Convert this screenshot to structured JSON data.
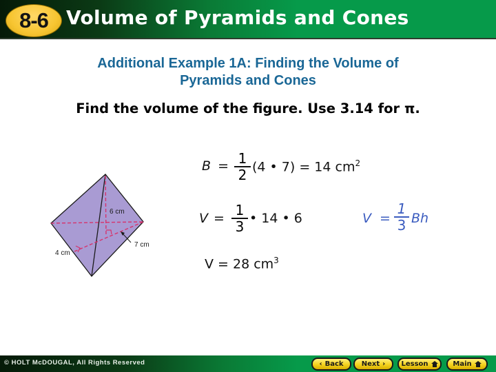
{
  "header": {
    "lesson_badge": "8-6",
    "title": "Volume of Pyramids and Cones",
    "colors": {
      "badge": "#f7c531",
      "band_dark": "#051a08",
      "band_green": "#069a4a"
    }
  },
  "example": {
    "heading_line1": "Additional Example 1A: Finding the Volume of",
    "heading_line2": "Pyramids and Cones",
    "heading_color": "#1a6796",
    "prompt": "Find the volume of the figure. Use 3.14 for π."
  },
  "figure": {
    "shape": "triangular pyramid",
    "fill_color": "#a99bd3",
    "labels": {
      "height": "6 cm",
      "base_height": "7 cm",
      "base_side": "4 cm"
    }
  },
  "work": {
    "base_area": {
      "lhs": "B",
      "eq": "=",
      "frac_num": "1",
      "frac_den": "2",
      "rhs": "(4 • 7) = 14 cm",
      "exp": "2"
    },
    "volume_setup": {
      "lhs": "V",
      "eq": "=",
      "frac_num": "1",
      "frac_den": "3",
      "rhs": "• 14 • 6"
    },
    "formula": {
      "lhs": "V",
      "eq": "=",
      "frac_num": "1",
      "frac_den": "3",
      "rhs": "Bh",
      "color": "#3a5bbf"
    },
    "result": {
      "text": "V = 28 cm",
      "exp": "3"
    }
  },
  "footer": {
    "copyright": "© HOLT McDOUGAL, All Rights Reserved",
    "nav": [
      {
        "label": "Back",
        "icon": "chevron-left-icon"
      },
      {
        "label": "Next",
        "icon": "chevron-right-icon"
      },
      {
        "label": "Lesson",
        "icon": "home-icon"
      },
      {
        "label": "Main",
        "icon": "home-icon"
      }
    ]
  }
}
